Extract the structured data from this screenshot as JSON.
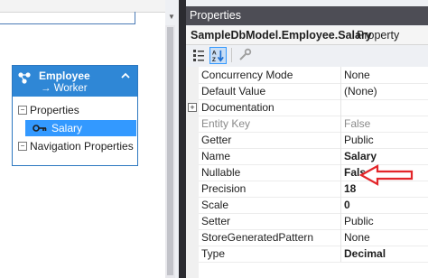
{
  "designer": {
    "entity": {
      "title": "Employee",
      "base_type": "→ Worker",
      "sections": {
        "properties_label": "Properties",
        "navigation_label": "Navigation Properties"
      },
      "selected_property": "Salary"
    }
  },
  "properties_window": {
    "title": "Properties",
    "object_name": "SampleDbModel.Employee.Salary",
    "object_type": "Property",
    "rows": [
      {
        "name": "Concurrency Mode",
        "value": "None"
      },
      {
        "name": "Default Value",
        "value": "(None)"
      },
      {
        "name": "Documentation",
        "value": ""
      },
      {
        "name": "Entity Key",
        "value": "False"
      },
      {
        "name": "Getter",
        "value": "Public"
      },
      {
        "name": "Name",
        "value": "Salary"
      },
      {
        "name": "Nullable",
        "value": "False"
      },
      {
        "name": "Precision",
        "value": "18"
      },
      {
        "name": "Scale",
        "value": "0"
      },
      {
        "name": "Setter",
        "value": "Public"
      },
      {
        "name": "StoreGeneratedPattern",
        "value": "None"
      },
      {
        "name": "Type",
        "value": "Decimal"
      }
    ]
  },
  "colors": {
    "accent": "#3399ff",
    "entity_header": "#2f87d6",
    "annotation_arrow": "#e3262a"
  }
}
